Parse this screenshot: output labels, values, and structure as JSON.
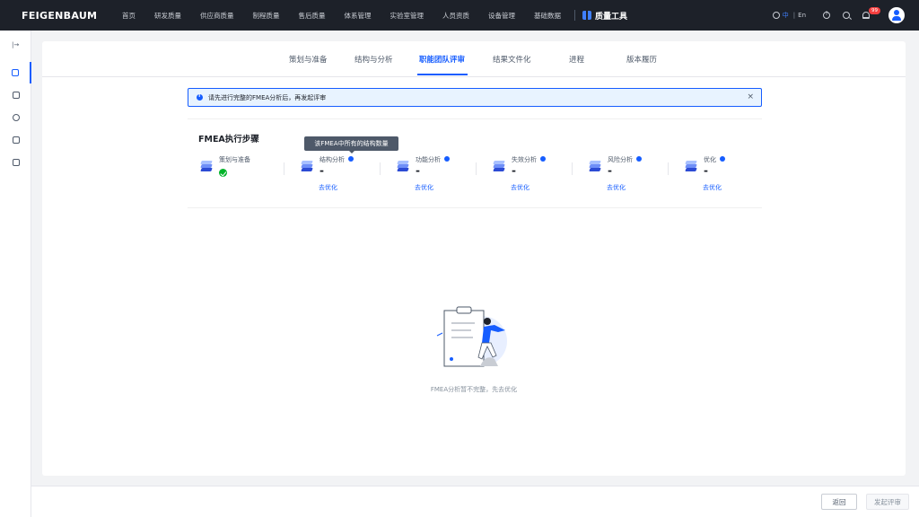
{
  "brand": "FEIGENBAUM",
  "nav": [
    "首页",
    "研发质量",
    "供应商质量",
    "制程质量",
    "售后质量",
    "体系管理",
    "实验室管理",
    "人员资质",
    "设备管理",
    "基础数据"
  ],
  "tool_title": "质量工具",
  "lang": {
    "zh": "中",
    "en": "En"
  },
  "notification_count": "99",
  "tabs": [
    "策划与准备",
    "结构与分析",
    "职能团队评审",
    "结果文件化",
    "进程",
    "版本履历"
  ],
  "active_tab": "职能团队评审",
  "alert": {
    "text": "请先进行完整的FMEA分析后，再发起评审",
    "close": "×"
  },
  "steps_title": "FMEA执行步骤",
  "tooltip": "该FMEA中所有的结构数量",
  "steps": [
    {
      "label": "策划与准备",
      "status": "done"
    },
    {
      "label": "结构分析",
      "value": "-",
      "link": "去优化"
    },
    {
      "label": "功能分析",
      "value": "-",
      "link": "去优化"
    },
    {
      "label": "失效分析",
      "value": "-",
      "link": "去优化"
    },
    {
      "label": "风险分析",
      "value": "-",
      "link": "去优化"
    },
    {
      "label": "优化",
      "value": "-",
      "link": "去优化"
    }
  ],
  "empty_text": "FMEA分析暂不完整，先去优化",
  "footer": {
    "back": "返回",
    "submit": "发起评审"
  },
  "colors": {
    "primary": "#165dff",
    "topbar": "#1d2129",
    "success": "#00b42a"
  }
}
